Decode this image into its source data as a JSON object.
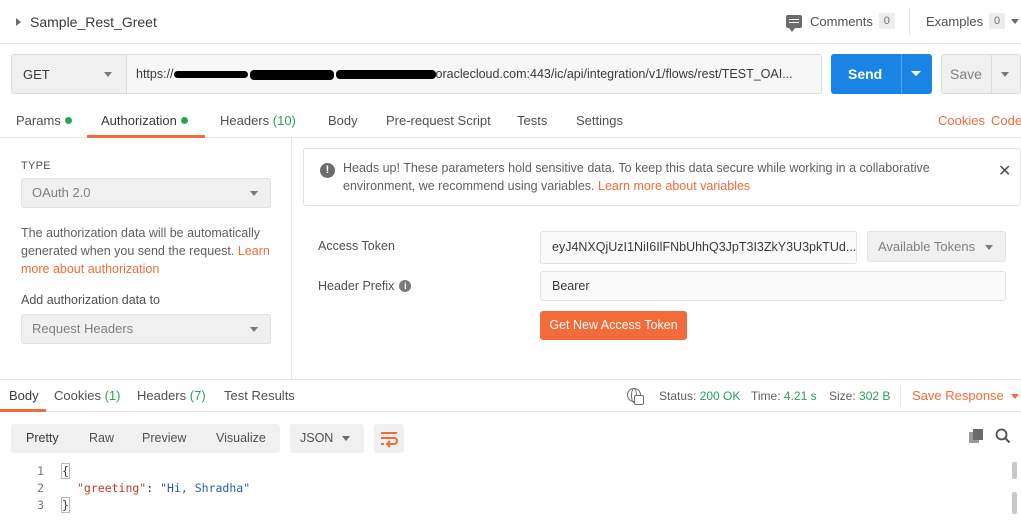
{
  "request": {
    "name": "Sample_Rest_Greet",
    "comments_label": "Comments",
    "comments_count": "0",
    "examples_label": "Examples",
    "examples_count": "0",
    "method": "GET",
    "url_prefix": "https://",
    "url_suffix": "oraclecloud.com:443/ic/api/integration/v1/flows/rest/TEST_OAI...",
    "send_label": "Send",
    "save_label": "Save"
  },
  "request_tabs": [
    {
      "label": "Params",
      "dot": true
    },
    {
      "label": "Authorization",
      "dot": true,
      "active": true
    },
    {
      "label": "Headers",
      "count": "(10)"
    },
    {
      "label": "Body"
    },
    {
      "label": "Pre-request Script"
    },
    {
      "label": "Tests"
    },
    {
      "label": "Settings"
    }
  ],
  "request_links": {
    "cookies": "Cookies",
    "code": "Code"
  },
  "auth": {
    "type_heading": "TYPE",
    "type_value": "OAuth 2.0",
    "description": "The authorization data will be automatically generated when you send the request.",
    "learn_more": "Learn more about authorization",
    "add_to_label": "Add authorization data to",
    "add_to_value": "Request Headers",
    "alert_text": "Heads up! These parameters hold sensitive data. To keep this data secure while working in a collaborative environment, we recommend using variables.",
    "alert_link": "Learn more about variables",
    "access_token_label": "Access Token",
    "access_token_value": "eyJ4NXQjUzI1NiI6IlFNbUhhQ3JpT3I3ZkY3U3pkTUd...",
    "available_tokens_label": "Available Tokens",
    "header_prefix_label": "Header Prefix",
    "header_prefix_value": "Bearer",
    "get_token_label": "Get New Access Token"
  },
  "response_tabs": [
    {
      "label": "Body",
      "active": true
    },
    {
      "label": "Cookies",
      "count": "(1)"
    },
    {
      "label": "Headers",
      "count": "(7)"
    },
    {
      "label": "Test Results"
    }
  ],
  "response_status": {
    "status_label": "Status:",
    "status_value": "200 OK",
    "time_label": "Time:",
    "time_value": "4.21 s",
    "size_label": "Size:",
    "size_value": "302 B",
    "save_response": "Save Response"
  },
  "response_view": {
    "views": [
      "Pretty",
      "Raw",
      "Preview",
      "Visualize"
    ],
    "format": "JSON"
  },
  "response_body": {
    "line_numbers": [
      "1",
      "2",
      "3"
    ],
    "open_brace": "{",
    "key": "\"greeting\"",
    "colon": ": ",
    "value": "\"Hi, Shradha\"",
    "close_brace": "}"
  },
  "colors": {
    "accent_orange": "#f26b3a",
    "send_blue": "#1a83e6",
    "success_green": "#27a35a"
  },
  "icons": [
    "caret-right-icon",
    "comment-icon",
    "chevron-down-icon",
    "info-icon",
    "close-icon",
    "help-icon",
    "globe-icon",
    "wrap-lines-icon",
    "copy-icon",
    "search-icon"
  ]
}
